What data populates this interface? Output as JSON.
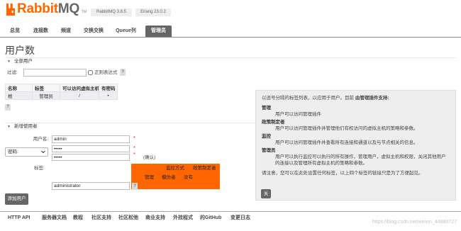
{
  "colors": {
    "brand_orange": "#ff6600",
    "brand_gray": "#666666",
    "tag_box_orange": "#ff6600",
    "dark_button": "#666666",
    "required_red": "#ff0000",
    "help_panel_bg": "#eeeeee"
  },
  "header": {
    "logo_rabbit": "Rabbit",
    "logo_mq": "MQ",
    "logo_tm": "TM",
    "logo_icon": "rabbitmq-logo-icon",
    "version_badge": "RabbitMQ 3.8.5",
    "erlang_badge": "Erlang 23.0.2"
  },
  "nav": {
    "tabs": [
      {
        "label": "总览",
        "active": false
      },
      {
        "label": "连接数",
        "active": false
      },
      {
        "label": "频道",
        "active": false
      },
      {
        "label": "交换交换",
        "active": false
      },
      {
        "label": "Queue列",
        "active": false
      },
      {
        "label": "管理员",
        "active": true
      }
    ]
  },
  "page_title": "用户数",
  "all_users": {
    "section_title": "全部用户",
    "section_icon": "collapse-arrow-icon",
    "filter_label": "过滤:",
    "regex_label": "正则表达式",
    "help": "?",
    "table": {
      "headers": [
        "名称",
        "标签",
        "可以访问虚拟主机",
        "有密码"
      ],
      "rows": [
        [
          "根",
          "管理员",
          "/",
          "•"
        ]
      ]
    },
    "table_help": "?"
  },
  "add_user": {
    "section_title": "新增使用者",
    "username_label": "用户名:",
    "username_value": "admin",
    "password_mode": "密码:",
    "password_value": "•••••",
    "password_confirm_value": "•••••",
    "required_mark": "*",
    "confirm_label": "(确认)",
    "tags_label": "标签:",
    "tag_options": [
      "监控方式",
      "政策制定者",
      "管理",
      "模仿者",
      "没有"
    ],
    "tags_value": "administrator",
    "tags_help": "?",
    "submit_label": "添加用户"
  },
  "help_panel": {
    "intro": "以逗号分隔的标签列表，以应用于用户。目前 ",
    "intro_bold": "由管理插件支持:",
    "tags": [
      {
        "name": "管理",
        "description": "用户可以访问管理插件"
      },
      {
        "name": "政策制定者",
        "description": "用户可以访问管理插件并管理他们有权访问的虚拟主机的策略和参数。"
      },
      {
        "name": "监控",
        "description": "用户可以访问管理插件并查看所有连接和通道以及与节点相关的信息。"
      },
      {
        "name": "管理员",
        "description": "用户可以执行监控可以执行的所有操作，管理用户，虚拟主机和权限，关闭其他用户的连接以及管理所有虚拟主机的策略和参数。"
      }
    ],
    "note": "请注意，您可以在此处设置任何标签，以上四个标签的链接只是为了方便起见。",
    "close_label": "关"
  },
  "footer": {
    "links": [
      "HTTP API",
      "服务器文档",
      "教程",
      "社区支持",
      "社区松弛",
      "商业支持",
      "外挂程式",
      "的GitHub",
      "变更日志"
    ]
  },
  "watermark": "https://blog.csdn.net/weixin_44880727"
}
